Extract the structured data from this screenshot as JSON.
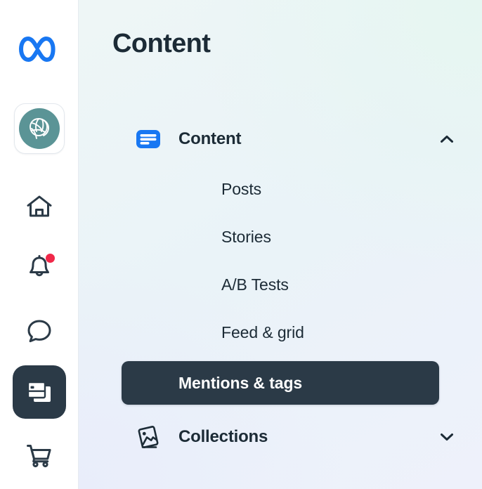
{
  "app": {
    "brand": "Meta",
    "accent_blue": "#1877f2",
    "dark": "#2b3a47",
    "avatar_teal": "#5b9496",
    "badge_red": "#f02849"
  },
  "rail": {
    "logo": {
      "name": "meta-logo",
      "label": "Meta"
    },
    "brand_avatar": {
      "name": "brand-avatar",
      "label": "Brand account"
    },
    "items": [
      {
        "name": "home",
        "label": "Home",
        "icon": "home-icon",
        "active": false,
        "badge": false
      },
      {
        "name": "notifications",
        "label": "Notifications",
        "icon": "bell-icon",
        "active": false,
        "badge": true
      },
      {
        "name": "messages",
        "label": "Messages",
        "icon": "chat-bubble-icon",
        "active": false,
        "badge": false
      },
      {
        "name": "content",
        "label": "Content",
        "icon": "content-cards-icon",
        "active": true,
        "badge": false
      },
      {
        "name": "commerce",
        "label": "Commerce",
        "icon": "shopping-cart-icon",
        "active": false,
        "badge": false
      }
    ]
  },
  "page": {
    "title": "Content"
  },
  "menu": {
    "groups": [
      {
        "id": "content",
        "label": "Content",
        "icon": "content-lines-icon",
        "expanded": true,
        "chevron": "chevron-up-icon",
        "items": [
          {
            "label": "Posts",
            "active": false
          },
          {
            "label": "Stories",
            "active": false
          },
          {
            "label": "A/B Tests",
            "active": false
          },
          {
            "label": "Feed & grid",
            "active": false
          },
          {
            "label": "Mentions & tags",
            "active": true
          }
        ]
      },
      {
        "id": "collections",
        "label": "Collections",
        "icon": "photo-stack-icon",
        "expanded": false,
        "chevron": "chevron-down-icon",
        "items": []
      }
    ]
  }
}
